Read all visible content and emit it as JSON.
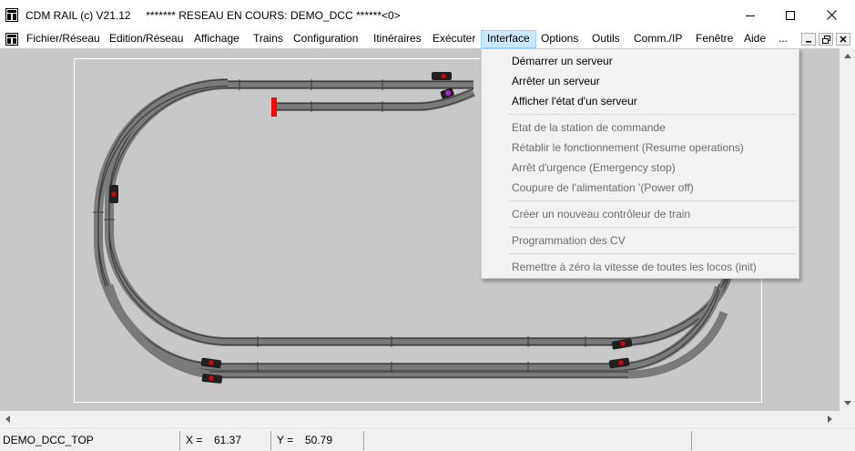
{
  "window": {
    "title": "CDM RAIL (c) V21.12     ******* RESEAU EN COURS: DEMO_DCC ******<0>",
    "controls": [
      "minimize",
      "maximize",
      "close"
    ]
  },
  "menubar": {
    "items": [
      {
        "label": "Fichier/Réseau"
      },
      {
        "label": "Edition/Réseau"
      },
      {
        "label": "Affichage"
      },
      {
        "label": "Trains"
      },
      {
        "label": "Configuration"
      },
      {
        "label": "Itinéraires"
      },
      {
        "label": "Exécuter"
      },
      {
        "label": "Interface",
        "active": true
      },
      {
        "label": "Options"
      },
      {
        "label": "Outils"
      },
      {
        "label": "Comm./IP"
      },
      {
        "label": "Fenêtre"
      },
      {
        "label": "Aide"
      },
      {
        "label": "..."
      }
    ]
  },
  "interface_menu": {
    "items": [
      {
        "label": "Démarrer un serveur",
        "enabled": true
      },
      {
        "label": "Arrêter un serveur",
        "enabled": true
      },
      {
        "label": "Afficher l'état d'un serveur",
        "enabled": true
      },
      {
        "separator": true
      },
      {
        "label": "Etat de la station de commande",
        "enabled": false
      },
      {
        "label": "Rétablir le fonctionnement (Resume operations)",
        "enabled": false
      },
      {
        "label": "Arrêt d'urgence (Emergency stop)",
        "enabled": false
      },
      {
        "label": "Coupure de l'alimentation '(Power off)",
        "enabled": false
      },
      {
        "separator": true
      },
      {
        "label": "Créer un nouveau contrôleur de train",
        "enabled": false
      },
      {
        "separator": true
      },
      {
        "label": "Programmation des CV",
        "enabled": false
      },
      {
        "separator": true
      },
      {
        "label": "Remettre à zéro la vitesse de toutes les locos (init)",
        "enabled": false
      }
    ]
  },
  "statusbar": {
    "layout_name": "DEMO_DCC_TOP",
    "x_label": "X =",
    "x_value": "61.37",
    "y_label": "Y =",
    "y_value": "50.79"
  },
  "colors": {
    "canvas_background": "#c8c8c8",
    "track_rail": "#3c3c3c",
    "track_bed": "#7a7a7a",
    "buffer_stop": "#ff0000",
    "train_light": "#e00000",
    "signal_marker": "#b020d0",
    "menu_highlight": "#cce8ff"
  },
  "icons": [
    "app-icon",
    "system-menu-icon",
    "minimize-icon",
    "maximize-icon",
    "close-icon",
    "scroll-up-icon",
    "scroll-down-icon",
    "scroll-left-icon",
    "scroll-right-icon"
  ]
}
